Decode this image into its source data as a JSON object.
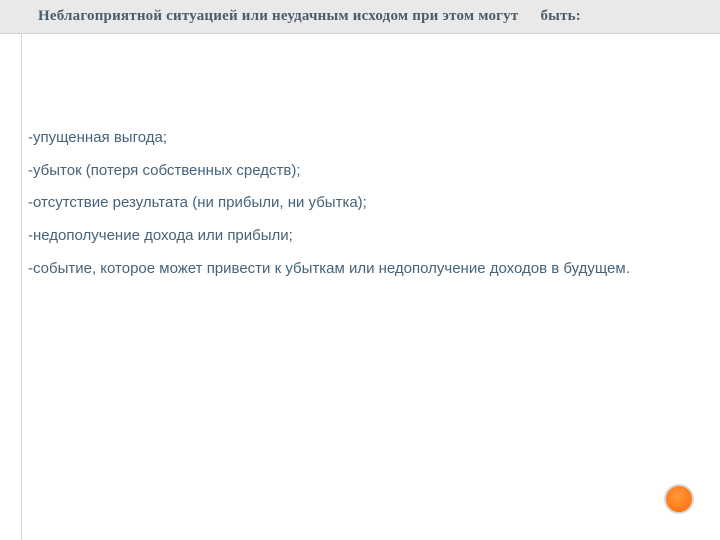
{
  "title": {
    "part1": "Неблагоприятной ситуацией или неудачным исходом при этом могут",
    "part2": "быть:"
  },
  "bullets": [
    "-упущенная выгода;",
    "-убыток (потеря собственных средств);",
    "-отсутствие результата (ни прибыли, ни убытка);",
    "-недополучение дохода или прибыли;",
    "-событие, которое может привести к убыткам или недополучение доходов в будущем."
  ]
}
